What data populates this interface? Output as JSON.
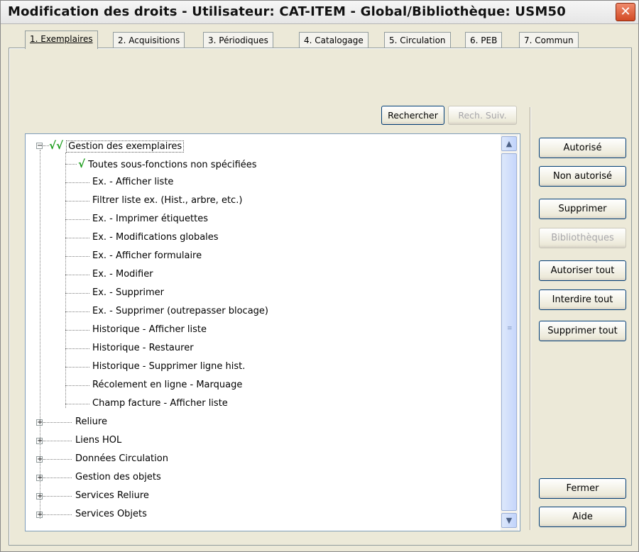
{
  "window": {
    "title": "Modification des droits - Utilisateur: CAT-ITEM - Global/Bibliothèque: USM50",
    "close_glyph": "✕"
  },
  "tabs": [
    {
      "label": "1. Exemplaires",
      "active": true
    },
    {
      "label": "2. Acquisitions"
    },
    {
      "label": "3. Périodiques"
    },
    {
      "label": "4. Catalogage"
    },
    {
      "label": "5. Circulation"
    },
    {
      "label": "6. PEB"
    },
    {
      "label": "7. Commun"
    }
  ],
  "search": {
    "search_label": "Rechercher",
    "search_next_label": "Rech. Suiv."
  },
  "tree": {
    "root": {
      "label": "Gestion des exemplaires",
      "checks": "√√",
      "expander": "−"
    },
    "children": [
      {
        "label": "Toutes sous-fonctions non spécifiées",
        "check": "√"
      },
      {
        "label": "Ex. - Afficher liste"
      },
      {
        "label": "Filtrer liste ex. (Hist., arbre, etc.)"
      },
      {
        "label": "Ex. - Imprimer étiquettes"
      },
      {
        "label": "Ex. - Modifications globales"
      },
      {
        "label": "Ex. - Afficher formulaire"
      },
      {
        "label": "Ex. - Modifier"
      },
      {
        "label": "Ex. - Supprimer"
      },
      {
        "label": "Ex. - Supprimer (outrepasser blocage)"
      },
      {
        "label": "Historique - Afficher liste"
      },
      {
        "label": "Historique - Restaurer"
      },
      {
        "label": "Historique - Supprimer ligne hist."
      },
      {
        "label": "Récolement en ligne - Marquage"
      },
      {
        "label": "Champ facture - Afficher liste"
      }
    ],
    "collapsed_nodes": [
      {
        "label": "Reliure",
        "expander": "+"
      },
      {
        "label": "Liens HOL",
        "expander": "+"
      },
      {
        "label": "Données Circulation",
        "expander": "+"
      },
      {
        "label": "Gestion des objets",
        "expander": "+"
      },
      {
        "label": "Services Reliure",
        "expander": "+"
      },
      {
        "label": "Services Objets",
        "expander": "+"
      }
    ]
  },
  "scrollbar": {
    "up_glyph": "▲",
    "down_glyph": "▼",
    "grip_glyph": "≡"
  },
  "actions": {
    "authorized": "Autorisé",
    "not_authorized": "Non autorisé",
    "delete": "Supprimer",
    "libraries": "Bibliothèques",
    "authorize_all": "Autoriser tout",
    "forbid_all": "Interdire tout",
    "delete_all": "Supprimer tout",
    "close": "Fermer",
    "help": "Aide"
  },
  "colors": {
    "check": "#1a9c1a",
    "title_close": "#d24a25"
  }
}
